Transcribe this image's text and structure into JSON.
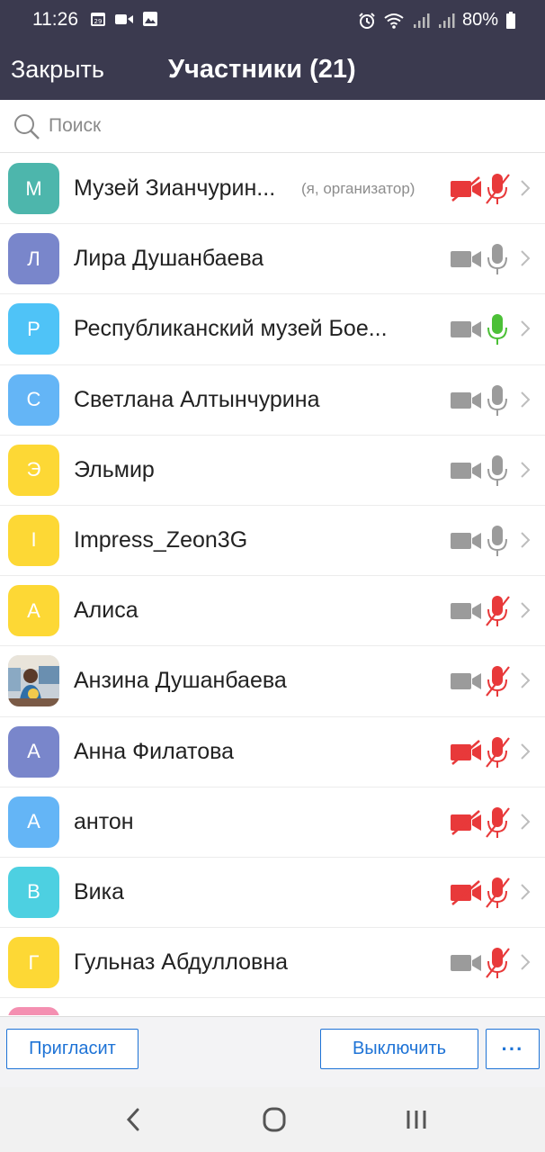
{
  "status_bar": {
    "time": "11:26",
    "battery": "80%",
    "left_icons": [
      "calendar-icon",
      "video-icon",
      "image-icon"
    ],
    "right_icons": [
      "alarm-icon",
      "wifi-icon",
      "signal-icon",
      "signal-icon",
      "battery-icon"
    ]
  },
  "header": {
    "close_label": "Закрыть",
    "title": "Участники (21)"
  },
  "search": {
    "placeholder": "Поиск"
  },
  "colors": {
    "header_bg": "#3b3a4f",
    "accent": "#1e73d6",
    "muted_red": "#e8393a",
    "active_green": "#4cc037",
    "neutral_icon": "#9b9b9b"
  },
  "participants": [
    {
      "initial": "М",
      "name": "Музей Зианчурин...",
      "role": "(я, организатор)",
      "avatar_color": "#4db6ac",
      "video": "off",
      "audio": "muted"
    },
    {
      "initial": "Л",
      "name": "Лира Душанбаева",
      "avatar_color": "#7986cb",
      "video": "on",
      "audio": "on"
    },
    {
      "initial": "Р",
      "name": "Республиканский музей Бое...",
      "avatar_color": "#4fc3f7",
      "video": "on",
      "audio": "speaking"
    },
    {
      "initial": "С",
      "name": "Светлана Алтынчурина",
      "avatar_color": "#64b5f6",
      "video": "on",
      "audio": "on"
    },
    {
      "initial": "Э",
      "name": "Эльмир",
      "avatar_color": "#fdd835",
      "video": "on",
      "audio": "on"
    },
    {
      "initial": "I",
      "name": "Impress_Zeon3G",
      "avatar_color": "#fdd835",
      "video": "on",
      "audio": "on"
    },
    {
      "initial": "А",
      "name": "Алиса",
      "avatar_color": "#fdd835",
      "video": "on",
      "audio": "muted"
    },
    {
      "initial": "",
      "name": "Анзина Душанбаева",
      "avatar_color": "photo",
      "video": "on",
      "audio": "muted"
    },
    {
      "initial": "А",
      "name": "Анна Филатова",
      "avatar_color": "#7986cb",
      "video": "off",
      "audio": "muted"
    },
    {
      "initial": "А",
      "name": "антон",
      "avatar_color": "#64b5f6",
      "video": "off",
      "audio": "muted"
    },
    {
      "initial": "В",
      "name": "Вика",
      "avatar_color": "#4dd0e1",
      "video": "off",
      "audio": "muted"
    },
    {
      "initial": "Г",
      "name": "Гульназ Абдулловна",
      "avatar_color": "#fdd835",
      "video": "on",
      "audio": "muted"
    },
    {
      "initial": "",
      "name": "",
      "avatar_color": "#f48fb1",
      "video": "",
      "audio": ""
    }
  ],
  "footer": {
    "invite_label": "Пригласит",
    "mute_label": "Выключить",
    "more_label": "···"
  },
  "nav": {
    "buttons": [
      "back-icon",
      "home-icon",
      "recents-icon"
    ]
  }
}
